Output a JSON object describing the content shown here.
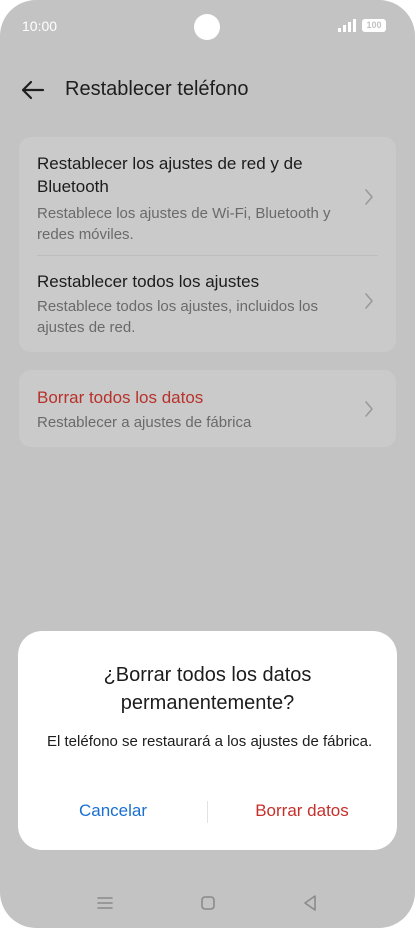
{
  "status_bar": {
    "time": "10:00",
    "battery": "100",
    "signal_icon": "signal-bars-icon"
  },
  "app_bar": {
    "title": "Restablecer teléfono",
    "back_icon": "arrow-left-icon"
  },
  "reset_options": [
    {
      "title": "Restablecer los ajustes de red y de Bluetooth",
      "subtitle": "Restablece los ajustes de Wi-Fi, Bluetooth y redes móviles."
    },
    {
      "title": "Restablecer todos los ajustes",
      "subtitle": "Restablece todos los ajustes, incluidos los ajustes de red."
    }
  ],
  "erase_option": {
    "title": "Borrar todos los datos",
    "subtitle": "Restablecer a ajustes de fábrica",
    "title_color": "#b8312a"
  },
  "dialog": {
    "title": "¿Borrar todos los datos permanentemente?",
    "message": "El teléfono se restaurará a los ajustes de fábrica.",
    "cancel_label": "Cancelar",
    "confirm_label": "Borrar datos",
    "cancel_color": "#1a6fd0",
    "confirm_color": "#c6302b"
  },
  "nav_bar": {
    "icons": [
      "menu-icon",
      "home-icon",
      "back-triangle-icon"
    ]
  },
  "colors": {
    "scrim_background": "#c3c3c4",
    "card_background": "#cacaca",
    "dialog_background": "#ffffff"
  }
}
